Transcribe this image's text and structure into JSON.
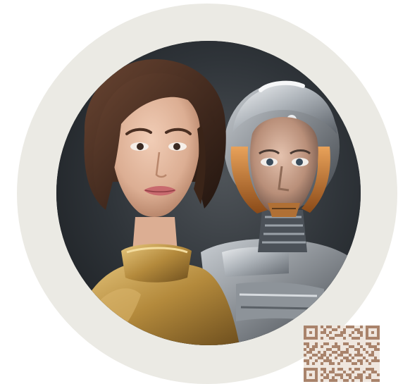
{
  "image": {
    "subject": "woman-and-robot-portrait",
    "frame_shape": "circle",
    "colors": {
      "page_background": "#ffffff",
      "outer_ring": "#ebeae4",
      "photo_background": "#2c3136",
      "woman_hair": "#4a2f22",
      "woman_skin": "#e5b9a0",
      "gold_garment": "#b48a3c",
      "robot_silver": "#c9cdd2",
      "robot_copper": "#c8742a",
      "qr_code": "#a9836b"
    }
  },
  "overlay": {
    "qr_code_icon": "qr-code-icon"
  }
}
